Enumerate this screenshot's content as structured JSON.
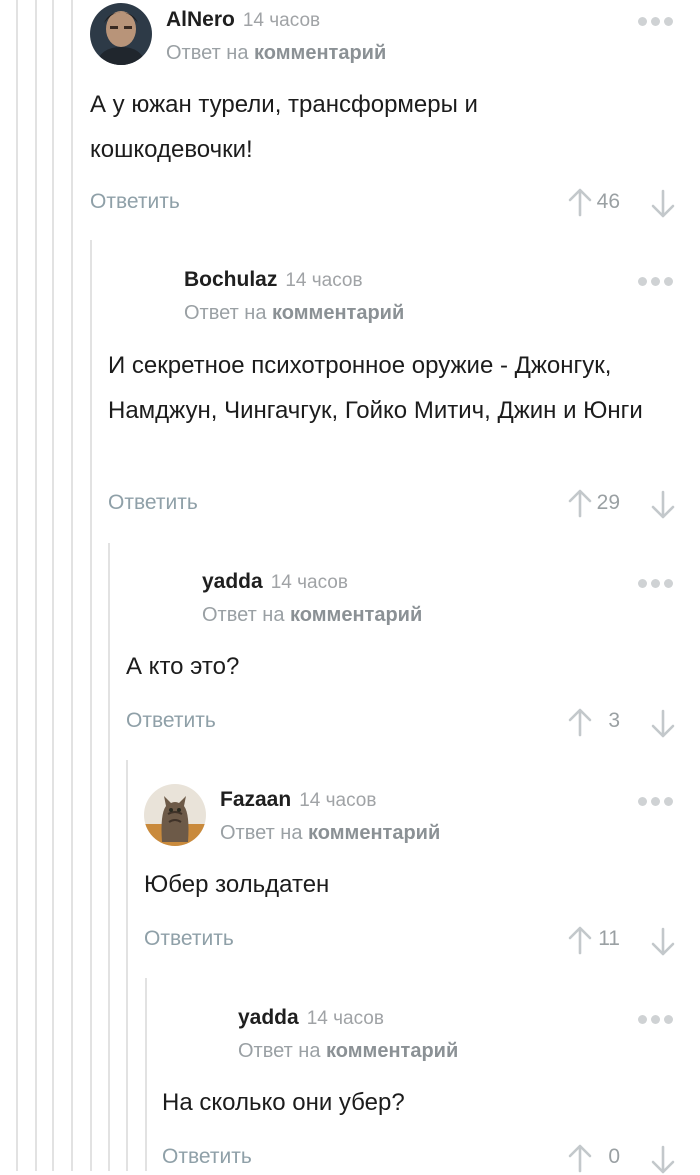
{
  "comments": [
    {
      "username": "AlNero",
      "time": "14 часов",
      "reply_prefix": "Ответ на",
      "reply_link": "комментарий",
      "text": "А у южан турели, трансформеры и кошкодевочки!",
      "reply_label": "Ответить",
      "rating": "46",
      "avatar": "avatar-man-dark"
    },
    {
      "username": "Bochulaz",
      "time": "14 часов",
      "reply_prefix": "Ответ на",
      "reply_link": "комментарий",
      "text": "И секретное психотронное оружие - Джонгук, Намджун, Чингачгук, Гойко Митич, Джин и Юнги",
      "reply_label": "Ответить",
      "rating": "29"
    },
    {
      "username": "yadda",
      "time": "14 часов",
      "reply_prefix": "Ответ на",
      "reply_link": "комментарий",
      "text": "А кто это?",
      "reply_label": "Ответить",
      "rating": "3"
    },
    {
      "username": "Fazaan",
      "time": "14 часов",
      "reply_prefix": "Ответ на",
      "reply_link": "комментарий",
      "text": "Юбер зольдатен",
      "reply_label": "Ответить",
      "rating": "11",
      "avatar": "avatar-cat"
    },
    {
      "username": "yadda",
      "time": "14 часов",
      "reply_prefix": "Ответ на",
      "reply_link": "комментарий",
      "text": "На сколько они убер?",
      "reply_label": "Ответить",
      "rating": "0"
    }
  ],
  "icons": {
    "upvote": "arrow-up-icon",
    "downvote": "arrow-down-icon",
    "more": "more-dots-icon"
  },
  "colors": {
    "thread_line": "#e2e2e2",
    "meta_text": "#9aa0a4",
    "reply_button": "#8fa0a8",
    "arrow": "#c3c8cb"
  }
}
